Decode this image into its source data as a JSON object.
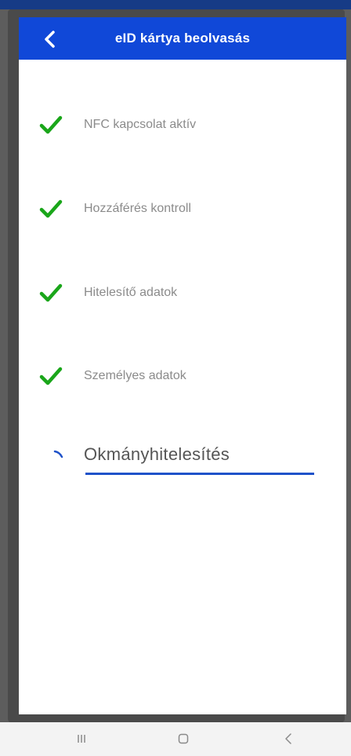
{
  "header": {
    "title": "eID kártya beolvasás"
  },
  "steps": [
    {
      "label": "NFC kapcsolat aktív",
      "status": "done"
    },
    {
      "label": "Hozzáférés kontroll",
      "status": "done"
    },
    {
      "label": "Hitelesítő adatok",
      "status": "done"
    },
    {
      "label": "Személyes adatok",
      "status": "done"
    },
    {
      "label": "Okmányhitelesítés",
      "status": "in-progress"
    }
  ],
  "colors": {
    "appbar": "#1048d8",
    "check": "#1aa61a",
    "progress": "#1f52c9"
  },
  "icons": {
    "back": "chevron-left-icon",
    "done": "check-icon",
    "loading": "spinner-icon",
    "nav_recent": "recent-apps-icon",
    "nav_home": "home-icon",
    "nav_back": "back-icon"
  }
}
